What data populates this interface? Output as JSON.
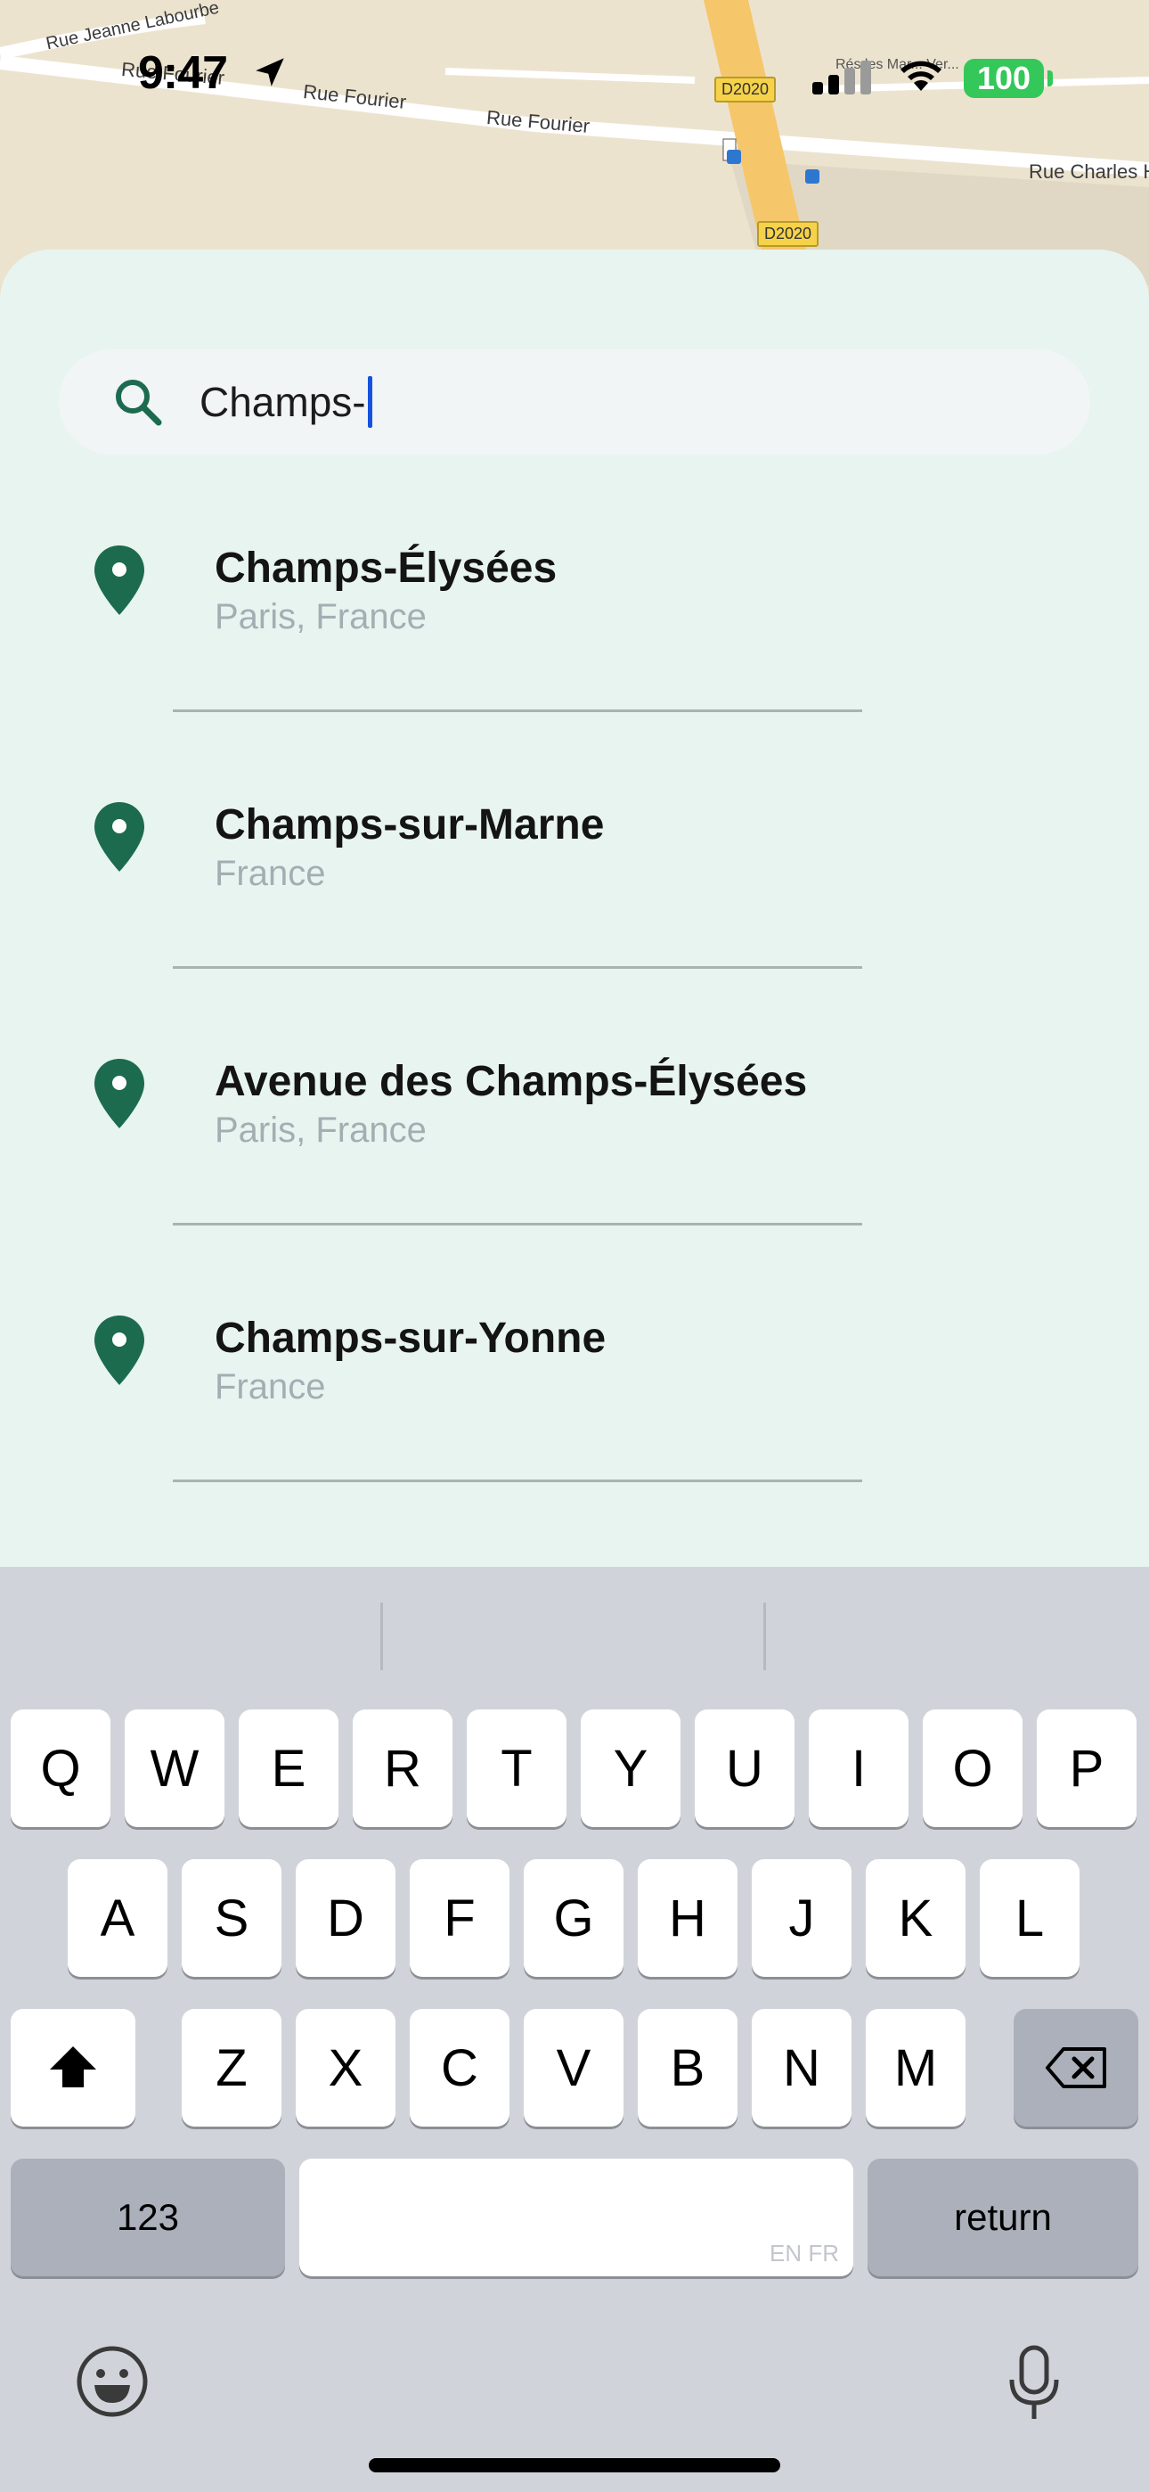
{
  "map": {
    "streets": [
      "Rue Jeanne Labourbe",
      "Rue Fourier",
      "Rue Fourier",
      "Rue Fourier",
      "Rue Charles H",
      "Rés les Mar... Ver..."
    ],
    "road_shields": [
      "D2020",
      "D2020"
    ]
  },
  "status_bar": {
    "time": "9:47",
    "battery": "100",
    "signal_bars_active": 2,
    "battery_color": "#34c759"
  },
  "search": {
    "query": "Champs-",
    "icon": "search-icon",
    "accent": "#1c6b4f"
  },
  "results": [
    {
      "title": "Champs-Élysées",
      "subtitle": "Paris, France",
      "icon": "map-pin-icon"
    },
    {
      "title": "Champs-sur-Marne",
      "subtitle": "France",
      "icon": "map-pin-icon"
    },
    {
      "title": "Avenue des Champs-Élysées",
      "subtitle": "Paris, France",
      "icon": "map-pin-icon"
    },
    {
      "title": "Champs-sur-Yonne",
      "subtitle": "France",
      "icon": "map-pin-icon"
    }
  ],
  "keyboard": {
    "row1": [
      "Q",
      "W",
      "E",
      "R",
      "T",
      "Y",
      "U",
      "I",
      "O",
      "P"
    ],
    "row2": [
      "A",
      "S",
      "D",
      "F",
      "G",
      "H",
      "J",
      "K",
      "L"
    ],
    "row3": [
      "Z",
      "X",
      "C",
      "V",
      "B",
      "N",
      "M"
    ],
    "numbers_label": "123",
    "return_label": "return",
    "space_hint": "EN FR"
  }
}
